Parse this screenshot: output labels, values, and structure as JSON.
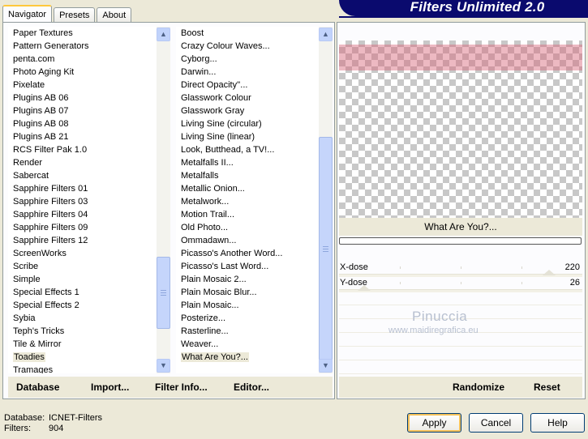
{
  "tabs": [
    {
      "label": "Navigator"
    },
    {
      "label": "Presets"
    },
    {
      "label": "About"
    }
  ],
  "banner": {
    "title": "Filters Unlimited 2.0"
  },
  "categories": [
    "Paper Textures",
    "Pattern Generators",
    "penta.com",
    "Photo Aging Kit",
    "Pixelate",
    "Plugins AB 06",
    "Plugins AB 07",
    "Plugins AB 08",
    "Plugins AB 21",
    "RCS Filter Pak 1.0",
    "Render",
    "Sabercat",
    "Sapphire Filters 01",
    "Sapphire Filters 03",
    "Sapphire Filters 04",
    "Sapphire Filters 09",
    "Sapphire Filters 12",
    "ScreenWorks",
    "Scribe",
    "Simple",
    "Special Effects 1",
    "Special Effects 2",
    "Sybia",
    "Teph's Tricks",
    "Tile & Mirror",
    "Toadies",
    "Tramages"
  ],
  "selected_category": "Toadies",
  "filters": [
    "Boost",
    "Crazy Colour Waves...",
    "Cyborg...",
    "Darwin...",
    "Direct Opacity''...",
    "Glasswork Colour",
    "Glasswork Gray",
    "Living Sine (circular)",
    "Living Sine (linear)",
    "Look, Butthead, a TV!...",
    "Metalfalls II...",
    "Metalfalls",
    "Metallic Onion...",
    "Metalwork...",
    "Motion Trail...",
    "Old Photo...",
    "Ommadawn...",
    "Picasso's Another Word...",
    "Picasso's Last Word...",
    "Plain Mosaic 2...",
    "Plain Mosaic Blur...",
    "Plain Mosaic...",
    "Posterize...",
    "Rasterline...",
    "Weaver...",
    "What Are You?..."
  ],
  "selected_filter": "What Are You?...",
  "left_bar": {
    "database": "Database",
    "import": "Import...",
    "filter_info": "Filter Info...",
    "editor": "Editor..."
  },
  "preview": {
    "filter_name": "What Are You?..."
  },
  "params": [
    {
      "label": "X-dose",
      "value": "220",
      "level": 0.863
    },
    {
      "label": "Y-dose",
      "value": "26",
      "level": 0.102
    }
  ],
  "watermark": {
    "name": "Pinuccia",
    "site": "www.maidiregrafica.eu"
  },
  "right_bar": {
    "randomize": "Randomize",
    "reset": "Reset"
  },
  "footer": {
    "database_key": "Database:",
    "database_val": "ICNET-Filters",
    "filters_key": "Filters:",
    "filters_val": "904",
    "apply": "Apply",
    "cancel": "Cancel",
    "help": "Help"
  },
  "colors": {
    "banner": "#0a0a6e",
    "accent": "#ffc83c",
    "preview_tint": "#d76478"
  }
}
